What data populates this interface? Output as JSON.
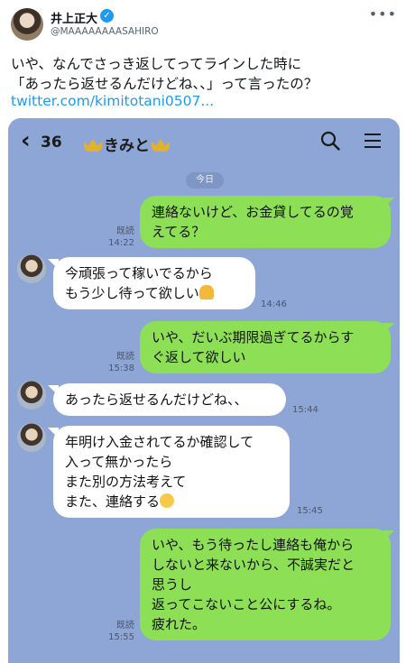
{
  "tweet": {
    "display_name": "井上正大",
    "handle": "@MAAAAAAAASAHIRO",
    "more_icon": "more-horizontal-icon",
    "verified_icon": "verified-badge-icon",
    "text_lines": [
      "いや、なんでさっき返してってラインした時に",
      "「あったら返せるんだけどね、、」って言ったの？"
    ],
    "link": "twitter.com/kimitotani0507..."
  },
  "line": {
    "back_icon": "back-chevron-icon",
    "unread_count": "36",
    "contact_name": "きみと",
    "search_icon": "search-icon",
    "menu_icon": "menu-icon",
    "date_label": "今日",
    "colors": {
      "background": "#8da6d6",
      "outgoing": "#8de055",
      "incoming": "#ffffff"
    },
    "messages": [
      {
        "dir": "out",
        "lines": [
          "連絡ないけど、お金貸してるの覚",
          "えてる？"
        ],
        "read": "既読",
        "time": "14:22"
      },
      {
        "dir": "in",
        "lines": [
          "今頑張って稼いでるから",
          "もう少し待って欲しい"
        ],
        "emoji": "folded-hands-emoji",
        "time": "14:46"
      },
      {
        "dir": "out",
        "lines": [
          "いや、だいぶ期限過ぎてるからす",
          "ぐ返して欲しい"
        ],
        "read": "既読",
        "time": "15:38"
      },
      {
        "dir": "in",
        "lines": [
          "あったら返せるんだけどね、、"
        ],
        "time": "15:44"
      },
      {
        "dir": "in",
        "lines": [
          "年明け入金されてるか確認して",
          "入って無かったら",
          "また別の方法考えて",
          "また、連絡する"
        ],
        "emoji": "relieved-face-emoji",
        "time": "15:45"
      },
      {
        "dir": "out",
        "lines": [
          "いや、もう待ったし連絡も俺から",
          "しないと来ないから、不誠実だと",
          "思うし",
          "返ってこないこと公にするね。",
          "疲れた。"
        ],
        "read": "既読",
        "time": "15:55"
      }
    ]
  }
}
